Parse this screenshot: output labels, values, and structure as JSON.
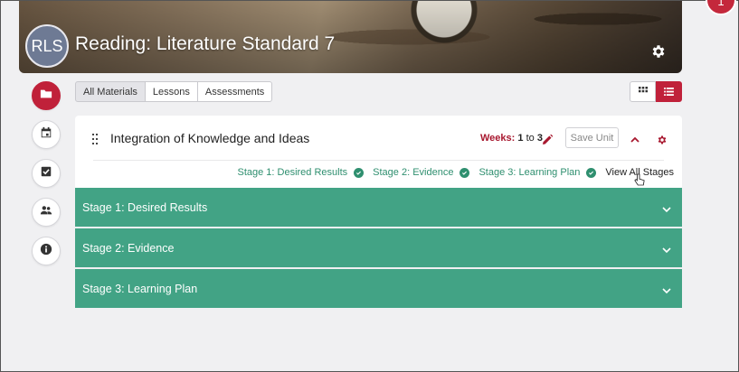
{
  "header": {
    "avatar_initials": "RLS",
    "title": "Reading: Literature Standard 7",
    "gear_icon": "gear-icon"
  },
  "rail": {
    "items": [
      {
        "icon": "folder-icon",
        "active": true
      },
      {
        "icon": "calendar-icon",
        "active": false
      },
      {
        "icon": "checkbox-icon",
        "active": false
      },
      {
        "icon": "people-icon",
        "active": false
      },
      {
        "icon": "info-icon",
        "active": false
      }
    ]
  },
  "tabs": [
    {
      "label": "All Materials",
      "selected": true
    },
    {
      "label": "Lessons",
      "selected": false
    },
    {
      "label": "Assessments",
      "selected": false
    }
  ],
  "view_toggle": {
    "options": [
      "grid-icon",
      "list-icon"
    ],
    "selected": "list-icon"
  },
  "unit": {
    "title": "Integration of Knowledge and Ideas",
    "weeks_label": "Weeks:",
    "weeks_from": "1",
    "weeks_to_word": "to",
    "weeks_to": "3",
    "save_label": "Save Unit"
  },
  "stages_nav": {
    "links": [
      "Stage 1: Desired Results",
      "Stage 2: Evidence",
      "Stage 3: Learning Plan"
    ],
    "view_all_label": "View All Stages"
  },
  "accordion": [
    "Stage 1: Desired Results",
    "Stage 2: Evidence",
    "Stage 3: Learning Plan"
  ],
  "colors": {
    "accent_red": "#c0213a",
    "stage_green": "#42a385",
    "link_green": "#2f8f6f"
  },
  "corner_badge": "1"
}
